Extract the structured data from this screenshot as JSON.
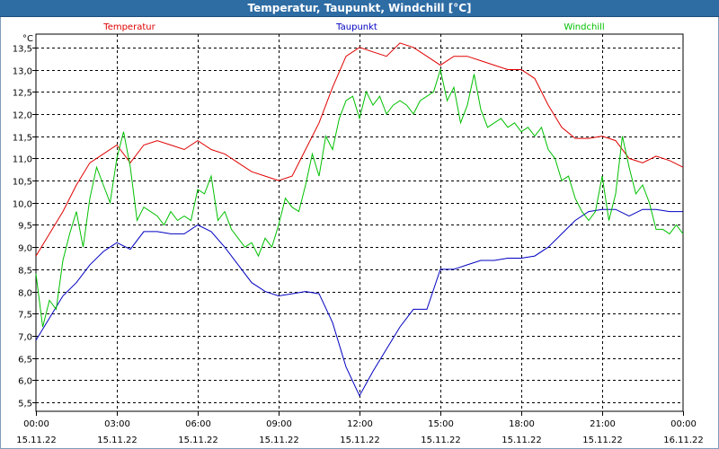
{
  "window": {
    "title": "Temperatur, Taupunkt, Windchill [°C]"
  },
  "chart_data": {
    "type": "line",
    "unit_label": "°C",
    "ylim": [
      5.3,
      13.8
    ],
    "y_ticks": [
      5.5,
      6.0,
      6.5,
      7.0,
      7.5,
      8.0,
      8.5,
      9.0,
      9.5,
      10.0,
      10.5,
      11.0,
      11.5,
      12.0,
      12.5,
      13.0,
      13.5
    ],
    "y_tick_labels": [
      "5,5",
      "6,0",
      "6,5",
      "7,0",
      "7,5",
      "8,0",
      "8,5",
      "9,0",
      "9,5",
      "10,0",
      "10,5",
      "11,0",
      "11,5",
      "12,0",
      "12,5",
      "13,0",
      "13,5"
    ],
    "x_range": [
      0,
      24
    ],
    "x_ticks": [
      {
        "time": "00:00",
        "date": "15.11.22",
        "h": 0
      },
      {
        "time": "03:00",
        "date": "15.11.22",
        "h": 3
      },
      {
        "time": "06:00",
        "date": "15.11.22",
        "h": 6
      },
      {
        "time": "09:00",
        "date": "15.11.22",
        "h": 9
      },
      {
        "time": "12:00",
        "date": "15.11.22",
        "h": 12
      },
      {
        "time": "15:00",
        "date": "15.11.22",
        "h": 15
      },
      {
        "time": "18:00",
        "date": "15.11.22",
        "h": 18
      },
      {
        "time": "21:00",
        "date": "15.11.22",
        "h": 21
      },
      {
        "time": "00:00",
        "date": "16.11.22",
        "h": 24
      }
    ],
    "grid": true,
    "series": [
      {
        "name": "Temperatur",
        "color": "#e00000",
        "x": [
          0,
          0.5,
          1,
          1.5,
          2,
          2.5,
          3,
          3.5,
          4,
          4.5,
          5,
          5.5,
          6,
          6.5,
          7,
          7.5,
          8,
          8.5,
          9,
          9.5,
          10,
          10.5,
          11,
          11.5,
          12,
          12.5,
          13,
          13.5,
          14,
          14.5,
          15,
          15.5,
          16,
          16.5,
          17,
          17.5,
          18,
          18.5,
          19,
          19.5,
          20,
          20.5,
          21,
          21.5,
          22,
          22.5,
          23,
          23.5,
          24
        ],
        "values": [
          8.8,
          9.3,
          9.8,
          10.4,
          10.9,
          11.1,
          11.3,
          10.9,
          11.3,
          11.4,
          11.3,
          11.2,
          11.4,
          11.2,
          11.1,
          10.9,
          10.7,
          10.6,
          10.5,
          10.6,
          11.2,
          11.8,
          12.6,
          13.3,
          13.5,
          13.4,
          13.3,
          13.6,
          13.5,
          13.3,
          13.1,
          13.3,
          13.3,
          13.2,
          13.1,
          13.0,
          13.0,
          12.8,
          12.2,
          11.7,
          11.45,
          11.45,
          11.5,
          11.4,
          11.0,
          10.9,
          11.05,
          10.95,
          10.8
        ]
      },
      {
        "name": "Taupunkt",
        "color": "#0000c0",
        "x": [
          0,
          0.5,
          1,
          1.5,
          2,
          2.5,
          3,
          3.5,
          4,
          4.5,
          5,
          5.5,
          6,
          6.5,
          7,
          7.5,
          8,
          8.5,
          9,
          9.5,
          10,
          10.5,
          11,
          11.5,
          12,
          12.5,
          13,
          13.5,
          14,
          14.5,
          15,
          15.5,
          16,
          16.5,
          17,
          17.5,
          18,
          18.5,
          19,
          19.5,
          20,
          20.5,
          21,
          21.5,
          22,
          22.5,
          23,
          23.5,
          24
        ],
        "values": [
          6.9,
          7.4,
          7.9,
          8.2,
          8.6,
          8.9,
          9.1,
          8.95,
          9.35,
          9.35,
          9.3,
          9.3,
          9.5,
          9.35,
          9.0,
          8.6,
          8.2,
          8.0,
          7.9,
          7.95,
          8.0,
          7.95,
          7.3,
          6.3,
          5.65,
          6.2,
          6.7,
          7.2,
          7.6,
          7.6,
          8.5,
          8.5,
          8.6,
          8.7,
          8.7,
          8.75,
          8.75,
          8.8,
          9.0,
          9.3,
          9.6,
          9.8,
          9.85,
          9.85,
          9.7,
          9.85,
          9.85,
          9.8,
          9.8
        ]
      },
      {
        "name": "Windchill",
        "color": "#00c000",
        "x": [
          0,
          0.25,
          0.5,
          0.75,
          1,
          1.25,
          1.5,
          1.75,
          2,
          2.25,
          2.5,
          2.75,
          3,
          3.25,
          3.5,
          3.75,
          4,
          4.25,
          4.5,
          4.75,
          5,
          5.25,
          5.5,
          5.75,
          6,
          6.25,
          6.5,
          6.75,
          7,
          7.25,
          7.5,
          7.75,
          8,
          8.25,
          8.5,
          8.75,
          9,
          9.25,
          9.5,
          9.75,
          10,
          10.25,
          10.5,
          10.75,
          11,
          11.25,
          11.5,
          11.75,
          12,
          12.25,
          12.5,
          12.75,
          13,
          13.25,
          13.5,
          13.75,
          14,
          14.25,
          14.5,
          14.75,
          15,
          15.25,
          15.5,
          15.75,
          16,
          16.25,
          16.5,
          16.75,
          17,
          17.25,
          17.5,
          17.75,
          18,
          18.25,
          18.5,
          18.75,
          19,
          19.25,
          19.5,
          19.75,
          20,
          20.25,
          20.5,
          20.75,
          21,
          21.25,
          21.5,
          21.75,
          22,
          22.25,
          22.5,
          22.75,
          23,
          23.25,
          23.5,
          23.75,
          24
        ],
        "values": [
          8.4,
          7.2,
          7.8,
          7.6,
          8.7,
          9.3,
          9.8,
          9.0,
          10.1,
          10.8,
          10.4,
          10.0,
          11.0,
          11.6,
          10.8,
          9.6,
          9.9,
          9.8,
          9.7,
          9.5,
          9.8,
          9.6,
          9.7,
          9.6,
          10.3,
          10.2,
          10.6,
          9.6,
          9.8,
          9.4,
          9.2,
          9.0,
          9.1,
          8.8,
          9.2,
          9.0,
          9.5,
          10.1,
          9.9,
          9.8,
          10.4,
          11.1,
          10.6,
          11.5,
          11.2,
          11.9,
          12.3,
          12.4,
          11.9,
          12.5,
          12.2,
          12.4,
          12.0,
          12.2,
          12.3,
          12.2,
          12.0,
          12.3,
          12.4,
          12.5,
          13.0,
          12.3,
          12.6,
          11.8,
          12.2,
          12.9,
          12.1,
          11.7,
          11.8,
          11.9,
          11.7,
          11.8,
          11.6,
          11.7,
          11.5,
          11.7,
          11.2,
          11.0,
          10.5,
          10.6,
          10.1,
          9.8,
          9.6,
          9.8,
          10.6,
          9.6,
          10.2,
          11.5,
          10.8,
          10.2,
          10.4,
          10.0,
          9.4,
          9.4,
          9.3,
          9.5,
          9.3
        ]
      }
    ]
  }
}
